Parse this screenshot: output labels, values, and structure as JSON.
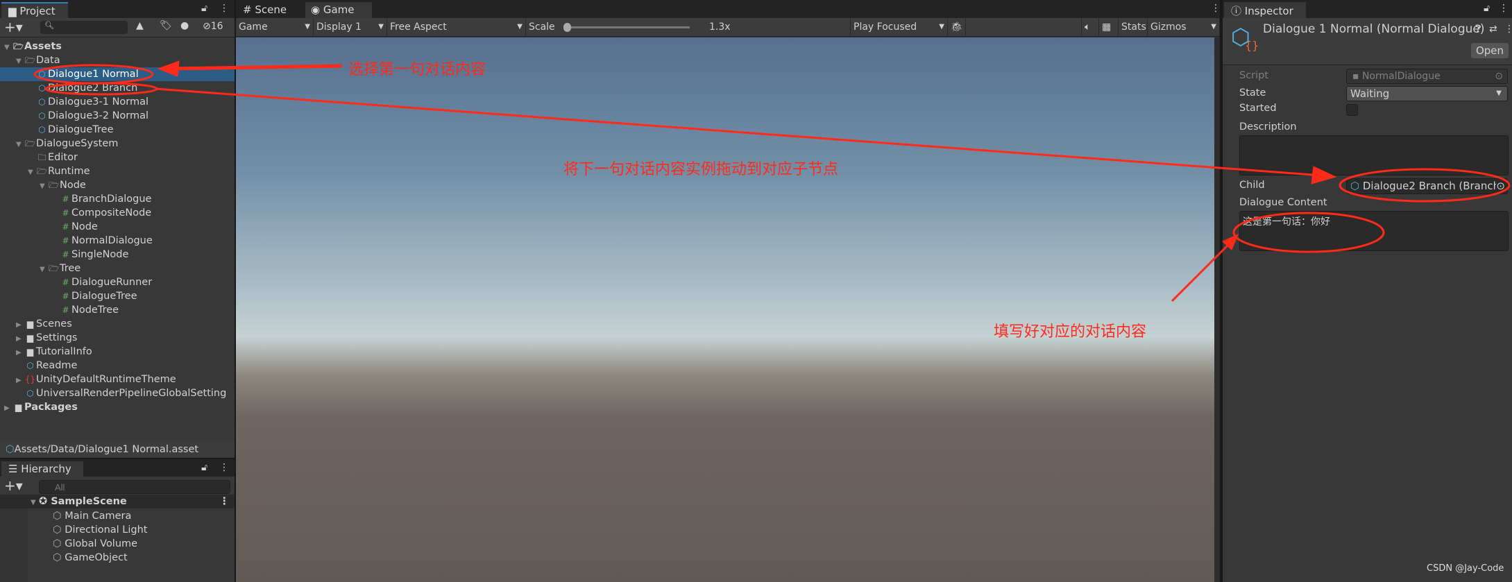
{
  "project": {
    "tab": "Project",
    "hidden_count": "16",
    "path": "Assets/Data/Dialogue1 Normal.asset",
    "tree": [
      {
        "label": "Assets",
        "level": 0,
        "icon": "folder-open-icon",
        "expanded": true,
        "bold": true
      },
      {
        "label": "Data",
        "level": 1,
        "icon": "folder-open-icon",
        "expanded": true
      },
      {
        "label": "Dialogue1 Normal",
        "level": 2,
        "icon": "scriptable-object-icon",
        "selected": true
      },
      {
        "label": "Dialogue2 Branch",
        "level": 2,
        "icon": "scriptable-object-icon"
      },
      {
        "label": "Dialogue3-1 Normal",
        "level": 2,
        "icon": "scriptable-object-icon"
      },
      {
        "label": "Dialogue3-2 Normal",
        "level": 2,
        "icon": "scriptable-object-icon"
      },
      {
        "label": "DialogueTree",
        "level": 2,
        "icon": "scriptable-object-icon"
      },
      {
        "label": "DialogueSystem",
        "level": 1,
        "icon": "folder-open-icon",
        "expanded": true
      },
      {
        "label": "Editor",
        "level": 2,
        "icon": "folder-empty-icon"
      },
      {
        "label": "Runtime",
        "level": 2,
        "icon": "folder-open-icon",
        "expanded": true
      },
      {
        "label": "Node",
        "level": 3,
        "icon": "folder-open-icon",
        "expanded": true
      },
      {
        "label": "BranchDialogue",
        "level": 4,
        "icon": "csharp-script-icon"
      },
      {
        "label": "CompositeNode",
        "level": 4,
        "icon": "csharp-script-icon"
      },
      {
        "label": "Node",
        "level": 4,
        "icon": "csharp-script-icon"
      },
      {
        "label": "NormalDialogue",
        "level": 4,
        "icon": "csharp-script-icon"
      },
      {
        "label": "SingleNode",
        "level": 4,
        "icon": "csharp-script-icon"
      },
      {
        "label": "Tree",
        "level": 3,
        "icon": "folder-open-icon",
        "expanded": true
      },
      {
        "label": "DialogueRunner",
        "level": 4,
        "icon": "csharp-script-icon"
      },
      {
        "label": "DialogueTree",
        "level": 4,
        "icon": "csharp-script-icon"
      },
      {
        "label": "NodeTree",
        "level": 4,
        "icon": "csharp-script-icon"
      },
      {
        "label": "Scenes",
        "level": 1,
        "icon": "folder-icon",
        "expanded": false
      },
      {
        "label": "Settings",
        "level": 1,
        "icon": "folder-icon",
        "expanded": false
      },
      {
        "label": "TutorialInfo",
        "level": 1,
        "icon": "folder-icon",
        "expanded": false
      },
      {
        "label": "Readme",
        "level": 1,
        "icon": "scriptable-object-icon"
      },
      {
        "label": "UnityDefaultRuntimeTheme",
        "level": 1,
        "icon": "style-sheet-icon",
        "expanded": false
      },
      {
        "label": "UniversalRenderPipelineGlobalSetting",
        "level": 1,
        "icon": "scriptable-object-icon"
      },
      {
        "label": "Packages",
        "level": 0,
        "icon": "folder-icon",
        "expanded": false,
        "bold": true
      }
    ]
  },
  "hierarchy": {
    "tab": "Hierarchy",
    "search_placeholder": "All",
    "scene": "SampleScene",
    "items": [
      "Main Camera",
      "Directional Light",
      "Global Volume",
      "GameObject"
    ]
  },
  "game": {
    "tabs": [
      "Scene",
      "Game"
    ],
    "mode": "Game",
    "display": "Display 1",
    "aspect": "Free Aspect",
    "scale_label": "Scale",
    "scale_value": "1.3x",
    "play_mode": "Play Focused",
    "stats": "Stats",
    "gizmos": "Gizmos"
  },
  "inspector": {
    "tab": "Inspector",
    "title": "Dialogue 1 Normal (Normal Dialogue)",
    "open": "Open",
    "script_label": "Script",
    "script_value": "NormalDialogue",
    "state_label": "State",
    "state_value": "Waiting",
    "started_label": "Started",
    "started": false,
    "description_label": "Description",
    "description_value": "",
    "child_label": "Child",
    "child_value": "Dialogue2 Branch (Branch I",
    "content_label": "Dialogue Content",
    "content_value": "这是第一句话：你好"
  },
  "annotations": {
    "a1": "选择第一句对话内容",
    "a2": "将下一句对话内容实例拖动到对应子节点",
    "a3": "填写好对应的对话内容",
    "color": "#ff2a1a"
  },
  "watermark": "CSDN @Jay-Code"
}
